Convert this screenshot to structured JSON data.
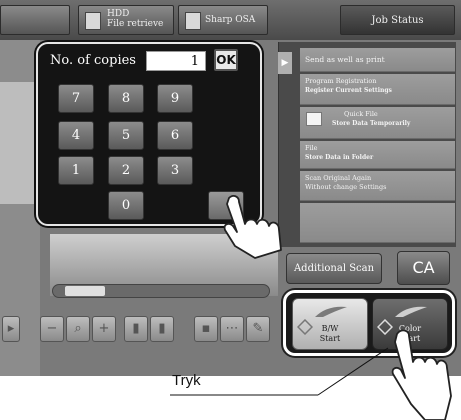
{
  "top_tabs": {
    "hdd_title": "HDD",
    "hdd_subtitle": "File retrieve",
    "sharp_osa": "Sharp OSA",
    "job_status": "Job Status"
  },
  "keypad": {
    "copies_label": "No. of copies",
    "copies_value": "1",
    "ok_label": "OK",
    "keys": [
      "7",
      "8",
      "9",
      "4",
      "5",
      "6",
      "1",
      "2",
      "3",
      "0"
    ]
  },
  "right_panel": {
    "send_print": "Send as well as print",
    "program_registration": "Program Registration",
    "register_settings": "Register Current Settings",
    "quick_file": "Quick File",
    "store_temp": "Store Data Temporarily",
    "file": "File",
    "store_folder": "Store Data in Folder",
    "scan_again": "Scan Original Again",
    "without_change": "Without change Settings"
  },
  "buttons": {
    "additional_scan": "Additional Scan",
    "ca": "CA",
    "bw_line1": "B/W",
    "bw_line2": "Start",
    "color_line1": "Color",
    "color_line2": "Start"
  },
  "callout": {
    "label": "Tryk"
  },
  "colors": {
    "screen_bg": "#8c8c8c",
    "panel_dark": "#141414",
    "highlight_border": "#ffffff"
  }
}
